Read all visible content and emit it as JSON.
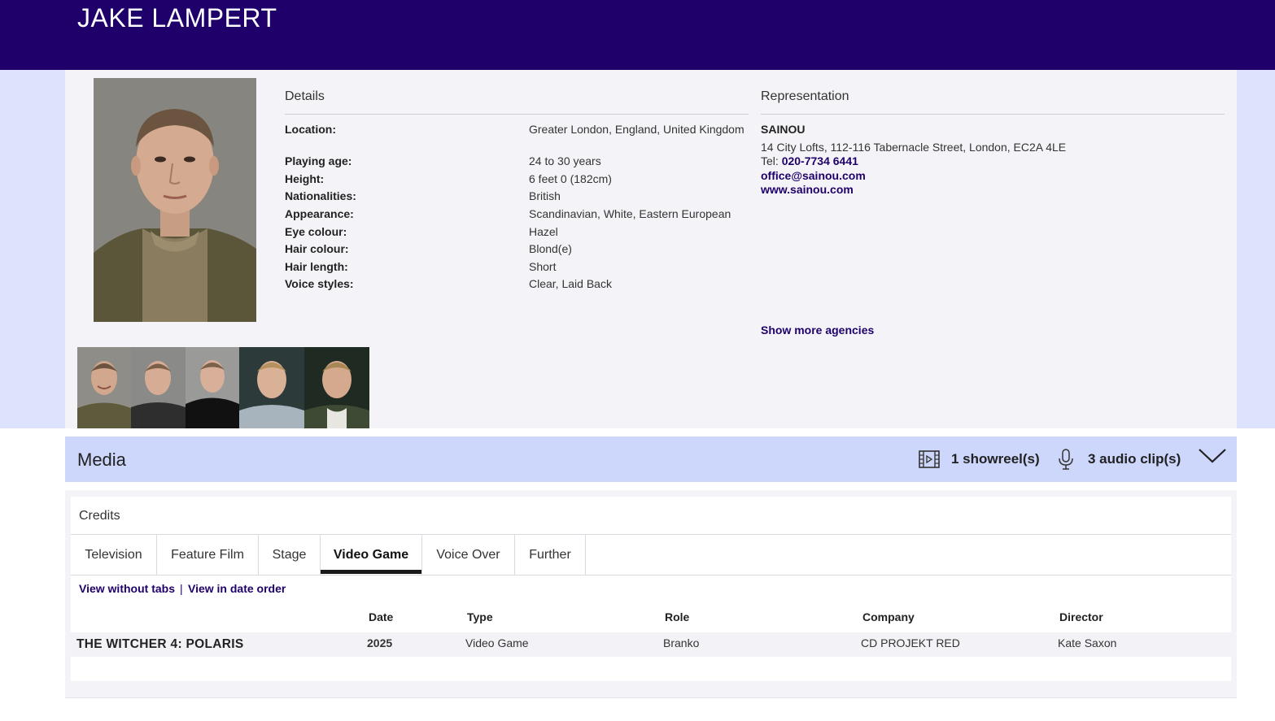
{
  "header": {
    "name": "JAKE LAMPERT"
  },
  "details": {
    "title": "Details",
    "rows": [
      {
        "label": "Location:",
        "value": "Greater London, England, United Kingdom"
      },
      {
        "label": "Playing age:",
        "value": "24 to 30 years"
      },
      {
        "label": "Height:",
        "value": "6 feet 0 (182cm)"
      },
      {
        "label": "Nationalities:",
        "value": "British"
      },
      {
        "label": "Appearance:",
        "value": "Scandinavian, White, Eastern European"
      },
      {
        "label": "Eye colour:",
        "value": "Hazel"
      },
      {
        "label": "Hair colour:",
        "value": "Blond(e)"
      },
      {
        "label": "Hair length:",
        "value": "Short"
      },
      {
        "label": "Voice styles:",
        "value": "Clear, Laid Back"
      }
    ]
  },
  "representation": {
    "title": "Representation",
    "agency": "SAINOU",
    "address": "14 City Lofts, 112-116 Tabernacle Street, London, EC2A 4LE",
    "tel_label": "Tel:",
    "tel": "020-7734 6441",
    "email": "office@sainou.com",
    "website": "www.sainou.com",
    "more": "Show more agencies"
  },
  "media": {
    "title": "Media",
    "showreels": "1 showreel(s)",
    "audio": "3 audio clip(s)"
  },
  "credits": {
    "title": "Credits",
    "tabs": [
      "Television",
      "Feature Film",
      "Stage",
      "Video Game",
      "Voice Over",
      "Further"
    ],
    "active_tab": "Video Game",
    "view_without_tabs": "View without tabs",
    "separator": "|",
    "view_date_order": "View in date order",
    "columns": [
      "Date",
      "Type",
      "Role",
      "Company",
      "Director"
    ],
    "rows": [
      {
        "title": "THE WITCHER 4: POLARIS",
        "date": "2025",
        "type": "Video Game",
        "role": "Branko",
        "company": "CD PROJEKT RED",
        "director": "Kate Saxon"
      }
    ]
  },
  "colors": {
    "header_bg": "#1f006b",
    "band_bg": "#dde3fd",
    "media_bg": "#cdd6fb",
    "link": "#1f006b"
  }
}
